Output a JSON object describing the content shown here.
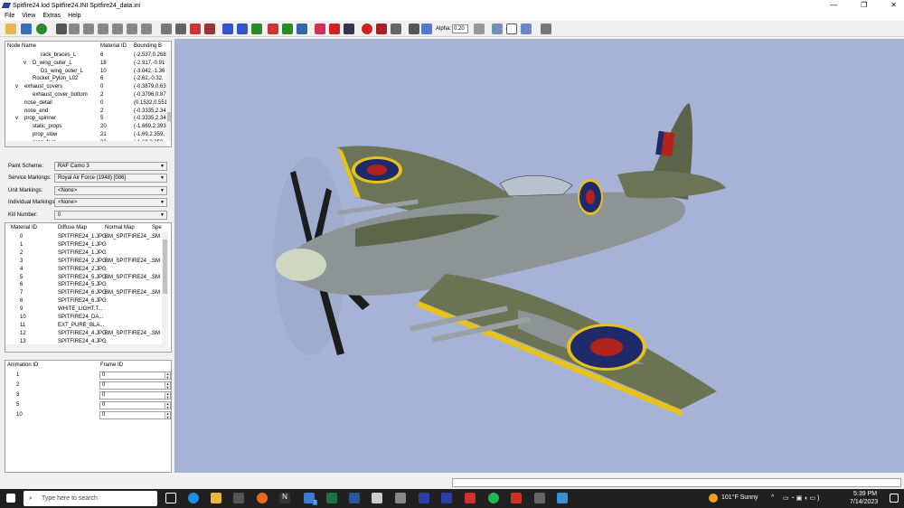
{
  "window": {
    "title": "Spitfire24.lod  Spitfire24.INI  Spitfire24_data.ini",
    "minimize": "—",
    "maximize": "❐",
    "close": "✕"
  },
  "menu": [
    "File",
    "View",
    "Extras",
    "Help"
  ],
  "toolbar": {
    "alpha_label": "Alpha:",
    "alpha_value": "0.20"
  },
  "node_tree": {
    "headers": [
      "Node Name",
      "Material ID",
      "Bounding B"
    ],
    "rows": [
      {
        "name": "rack_braces_L",
        "indent": 4,
        "expander": "",
        "mat": "6",
        "bb": "(-2.537,0.268"
      },
      {
        "name": "D_wing_outer_L",
        "indent": 3,
        "expander": "v",
        "mat": "18",
        "bb": "(-2.917,-0.91"
      },
      {
        "name": "D1_wing_outer_L",
        "indent": 4,
        "expander": "",
        "mat": "10",
        "bb": "(-3.042,-1.36"
      },
      {
        "name": "Rocket_Pylon_L02",
        "indent": 3,
        "expander": "",
        "mat": "6",
        "bb": "(-2.62,-0.32,"
      },
      {
        "name": "exhaust_covers",
        "indent": 2,
        "expander": "v",
        "mat": "0",
        "bb": "(-0.3879,0.63"
      },
      {
        "name": "exhaust_cover_bottom",
        "indent": 3,
        "expander": "",
        "mat": "2",
        "bb": "(-0.3796,0.87"
      },
      {
        "name": "nose_detail",
        "indent": 2,
        "expander": "",
        "mat": "0",
        "bb": "(0.1532,0.551"
      },
      {
        "name": "nose_end",
        "indent": 2,
        "expander": "",
        "mat": "2",
        "bb": "(-0.3335,2.34"
      },
      {
        "name": "prop_spinner",
        "indent": 2,
        "expander": "v",
        "mat": "5",
        "bb": "(-0.3335,2.34"
      },
      {
        "name": "static_props",
        "indent": 3,
        "expander": "",
        "mat": "20",
        "bb": "(-1.669,2.393"
      },
      {
        "name": "prop_slow",
        "indent": 3,
        "expander": "",
        "mat": "21",
        "bb": "(-1.69,2.359,"
      },
      {
        "name": "prop_fast",
        "indent": 3,
        "expander": "",
        "mat": "22",
        "bb": "(-1.69,2.359,"
      }
    ]
  },
  "settings": [
    {
      "label": "Paint Scheme:",
      "value": "RAF Camo 3"
    },
    {
      "label": "Service Markings:",
      "value": "Royal Air Force (1948) [006]"
    },
    {
      "label": "Unit Markings:",
      "value": "<None>"
    },
    {
      "label": "Individual Markings:",
      "value": "<None>"
    },
    {
      "label": "Kill Number:",
      "value": "0"
    }
  ],
  "materials": {
    "headers": [
      "Material ID",
      "Diffuse Map",
      "Normal Map",
      "Spe"
    ],
    "rows": [
      {
        "id": "0",
        "diffuse": "SPITFIRE24_1.JPG",
        "normal": "BM_SPITFIRE24_...",
        "spec": "SM"
      },
      {
        "id": "1",
        "diffuse": "SPITFIRE24_1.JPG",
        "normal": "",
        "spec": ""
      },
      {
        "id": "2",
        "diffuse": "SPITFIRE24_1.JPG",
        "normal": "",
        "spec": ""
      },
      {
        "id": "3",
        "diffuse": "SPITFIRE24_2.JPG",
        "normal": "BM_SPITFIRE24_...",
        "spec": "SM"
      },
      {
        "id": "4",
        "diffuse": "SPITFIRE24_2.JPG",
        "normal": "",
        "spec": ""
      },
      {
        "id": "5",
        "diffuse": "SPITFIRE24_5.JPG",
        "normal": "BM_SPITFIRE24_...",
        "spec": "SM"
      },
      {
        "id": "6",
        "diffuse": "SPITFIRE24_5.JPG",
        "normal": "",
        "spec": ""
      },
      {
        "id": "7",
        "diffuse": "SPITFIRE24_6.JPG",
        "normal": "BM_SPITFIRE24_...",
        "spec": "SM"
      },
      {
        "id": "8",
        "diffuse": "SPITFIRE24_6.JPG",
        "normal": "",
        "spec": ""
      },
      {
        "id": "9",
        "diffuse": "WHITE_LIGHT.T...",
        "normal": "",
        "spec": ""
      },
      {
        "id": "10",
        "diffuse": "SPITFIRE24_DA...",
        "normal": "",
        "spec": ""
      },
      {
        "id": "11",
        "diffuse": "EXT_PURE_BLA...",
        "normal": "",
        "spec": ""
      },
      {
        "id": "12",
        "diffuse": "SPITFIRE24_4.JPG",
        "normal": "BM_SPITFIRE24_...",
        "spec": "SM"
      },
      {
        "id": "13",
        "diffuse": "SPITFIRE24_4.JPG",
        "normal": "",
        "spec": ""
      }
    ]
  },
  "animations": {
    "headers": [
      "Animation ID",
      "Frame ID"
    ],
    "rows": [
      {
        "id": "1",
        "frame": "0"
      },
      {
        "id": "2",
        "frame": "0"
      },
      {
        "id": "3",
        "frame": "0"
      },
      {
        "id": "5",
        "frame": "0"
      },
      {
        "id": "10",
        "frame": "0"
      }
    ]
  },
  "taskbar": {
    "search_placeholder": "Type here to search",
    "weather": "101°F  Sunny",
    "time": "5:39 PM",
    "date": "7/14/2023",
    "notif_count": "1"
  },
  "colors": {
    "viewport_bg": "#a6b3d6",
    "camo_dark": "#5b6448",
    "camo_grey": "#8d9297",
    "roundel_blue": "#1f2a6b",
    "roundel_red": "#b3231d",
    "roundel_yellow": "#e8c317"
  }
}
